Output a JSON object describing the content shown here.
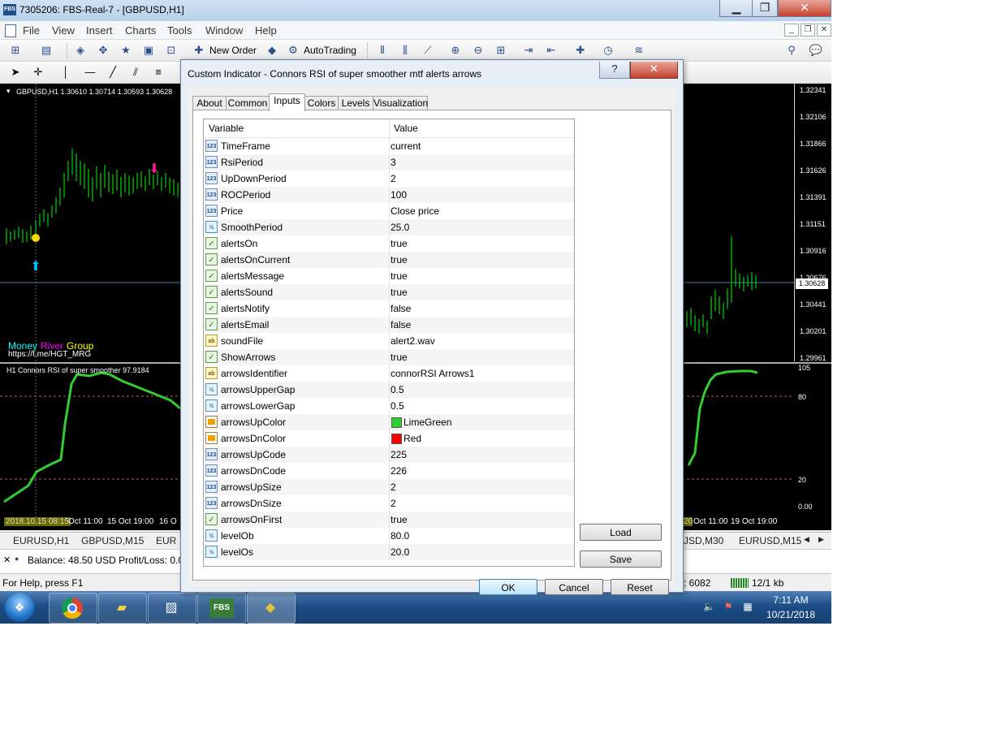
{
  "window": {
    "title": "7305206: FBS-Real-7 - [GBPUSD,H1]",
    "app_icon_text": "FBS"
  },
  "menu": [
    "File",
    "View",
    "Insert",
    "Charts",
    "Tools",
    "Window",
    "Help"
  ],
  "toolbar": {
    "new_order": "New Order",
    "autotrading": "AutoTrading"
  },
  "chart": {
    "header": "GBPUSD,H1  1.30610 1.30714 1.30593 1.30628",
    "price_labels": [
      "1.32341",
      "1.32106",
      "1.31866",
      "1.31626",
      "1.31391",
      "1.31151",
      "1.30916",
      "1.30676",
      "1.30441",
      "1.30201",
      "1.29961"
    ],
    "current_price": "1.30628",
    "brand_money": "Money",
    "brand_river": "River",
    "brand_group": "Group",
    "brand_link": "https://t.me/HGT_MRG",
    "indicator_header": "H1 Connors RSI of super smoother 97.9184",
    "indicator_levels": [
      "105",
      "80",
      "20",
      "0.00"
    ],
    "time_left": [
      "2018.10.15 08:15",
      "Oct 11:00",
      "15 Oct 19:00",
      "16 O"
    ],
    "time_right": [
      "20",
      "Oct 11:00",
      "19 Oct 19:00"
    ]
  },
  "symbol_tabs": {
    "left": [
      "EURUSD,H1",
      "GBPUSD,M15",
      "EUR"
    ],
    "right": [
      "JSD,M30",
      "EURUSD,M15"
    ]
  },
  "terminal": {
    "balance": "Balance: 48.50 USD  Profit/Loss: 0.00"
  },
  "status": {
    "help": "For Help, press F1",
    "right_value": ": 6082",
    "traffic": "12/1 kb"
  },
  "taskbar": {
    "time": "7:11 AM",
    "date": "10/21/2018",
    "fbs_label": "FBS"
  },
  "dialog": {
    "title": "Custom Indicator - Connors RSI of super smoother mtf alerts arrows",
    "tabs": [
      "About",
      "Common",
      "Inputs",
      "Colors",
      "Levels",
      "Visualization"
    ],
    "active_tab": "Inputs",
    "columns": {
      "variable": "Variable",
      "value": "Value"
    },
    "params": [
      {
        "name": "TimeFrame",
        "value": "current",
        "type": "int"
      },
      {
        "name": "RsiPeriod",
        "value": "3",
        "type": "int"
      },
      {
        "name": "UpDownPeriod",
        "value": "2",
        "type": "int"
      },
      {
        "name": "ROCPeriod",
        "value": "100",
        "type": "int"
      },
      {
        "name": "Price",
        "value": "Close price",
        "type": "int"
      },
      {
        "name": "SmoothPeriod",
        "value": "25.0",
        "type": "double"
      },
      {
        "name": "alertsOn",
        "value": "true",
        "type": "bool"
      },
      {
        "name": "alertsOnCurrent",
        "value": "true",
        "type": "bool"
      },
      {
        "name": "alertsMessage",
        "value": "true",
        "type": "bool"
      },
      {
        "name": "alertsSound",
        "value": "true",
        "type": "bool"
      },
      {
        "name": "alertsNotify",
        "value": "false",
        "type": "bool"
      },
      {
        "name": "alertsEmail",
        "value": "false",
        "type": "bool"
      },
      {
        "name": "soundFile",
        "value": "alert2.wav",
        "type": "string"
      },
      {
        "name": "ShowArrows",
        "value": "true",
        "type": "bool"
      },
      {
        "name": "arrowsIdentifier",
        "value": "connorRSI Arrows1",
        "type": "string"
      },
      {
        "name": "arrowsUpperGap",
        "value": "0.5",
        "type": "double"
      },
      {
        "name": "arrowsLowerGap",
        "value": "0.5",
        "type": "double"
      },
      {
        "name": "arrowsUpColor",
        "value": "LimeGreen",
        "type": "color",
        "swatch": "#32cd32"
      },
      {
        "name": "arrowsDnColor",
        "value": "Red",
        "type": "color",
        "swatch": "#ff0000"
      },
      {
        "name": "arrowsUpCode",
        "value": "225",
        "type": "int"
      },
      {
        "name": "arrowsDnCode",
        "value": "226",
        "type": "int"
      },
      {
        "name": "arrowsUpSize",
        "value": "2",
        "type": "int"
      },
      {
        "name": "arrowsDnSize",
        "value": "2",
        "type": "int"
      },
      {
        "name": "arrowsOnFirst",
        "value": "true",
        "type": "bool"
      },
      {
        "name": "levelOb",
        "value": "80.0",
        "type": "double"
      },
      {
        "name": "levelOs",
        "value": "20.0",
        "type": "double"
      }
    ],
    "buttons": {
      "load": "Load",
      "save": "Save",
      "ok": "OK",
      "cancel": "Cancel",
      "reset": "Reset"
    }
  },
  "colors": {
    "chart_bg": "#000000",
    "candle": "#00ff00",
    "rsi_line": "#32cd32",
    "up_arrow": "#00bfff",
    "down_arrow": "#ff1493"
  }
}
